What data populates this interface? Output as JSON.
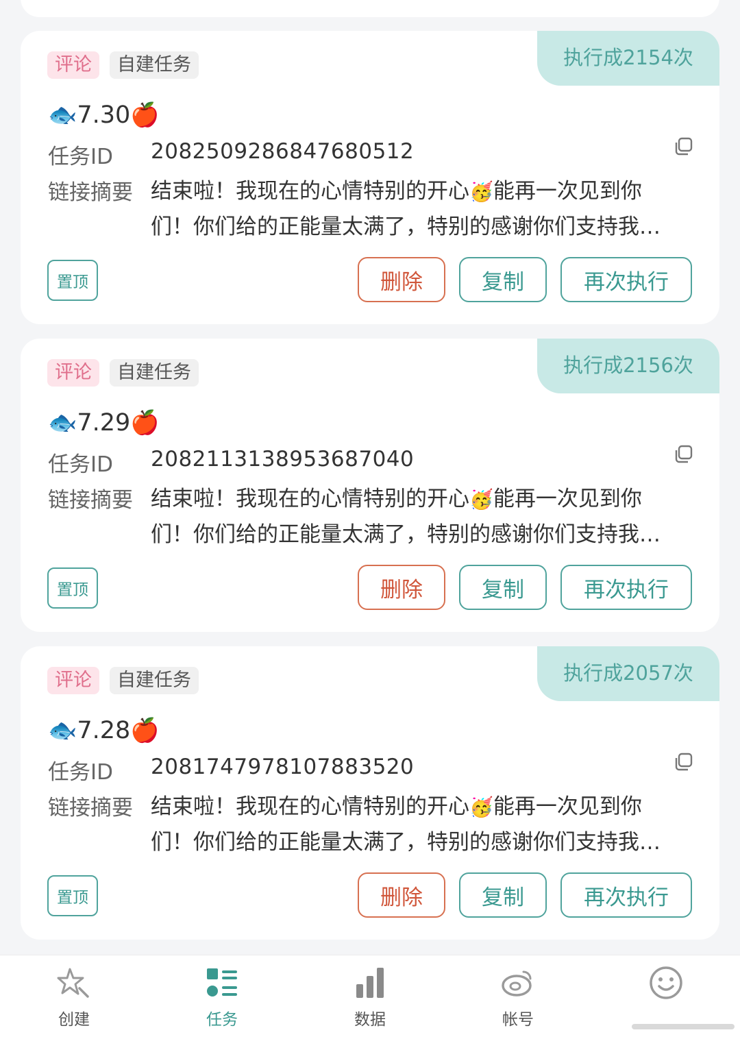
{
  "tasks": [
    {
      "exec_text": "执行成2154次",
      "tag_comment": "评论",
      "tag_self": "自建任务",
      "title": "7.30",
      "id_label": "任务ID",
      "task_id": "2082509286847680512",
      "summary_label": "链接摘要",
      "summary_a": "结束啦！我现在的心情特别的开心",
      "summary_b": "能再一次见到你们！你们给的正能量太满了，特别的感谢你们支持我…",
      "pin_label": "置顶",
      "delete_label": "删除",
      "copy_label": "复制",
      "rerun_label": "再次执行"
    },
    {
      "exec_text": "执行成2156次",
      "tag_comment": "评论",
      "tag_self": "自建任务",
      "title": "7.29",
      "id_label": "任务ID",
      "task_id": "2082113138953687040",
      "summary_label": "链接摘要",
      "summary_a": "结束啦！我现在的心情特别的开心",
      "summary_b": "能再一次见到你们！你们给的正能量太满了，特别的感谢你们支持我…",
      "pin_label": "置顶",
      "delete_label": "删除",
      "copy_label": "复制",
      "rerun_label": "再次执行"
    },
    {
      "exec_text": "执行成2057次",
      "tag_comment": "评论",
      "tag_self": "自建任务",
      "title": "7.28",
      "id_label": "任务ID",
      "task_id": "2081747978107883520",
      "summary_label": "链接摘要",
      "summary_a": "结束啦！我现在的心情特别的开心",
      "summary_b": "能再一次见到你们！你们给的正能量太满了，特别的感谢你们支持我…",
      "pin_label": "置顶",
      "delete_label": "删除",
      "copy_label": "复制",
      "rerun_label": "再次执行"
    }
  ],
  "nav": {
    "create": "创建",
    "tasks": "任务",
    "data": "数据",
    "account": "帐号"
  },
  "colors": {
    "accent": "#3a9990",
    "danger": "#d0563a",
    "badge_bg": "#c8e9e6",
    "tag_comment": "#e06f8c"
  },
  "icons": [
    "fish-emoji",
    "apple-emoji",
    "party-face-emoji",
    "copy-icon",
    "star-icon",
    "task-list-icon",
    "bar-chart-icon",
    "weibo-icon",
    "smiley-icon"
  ]
}
